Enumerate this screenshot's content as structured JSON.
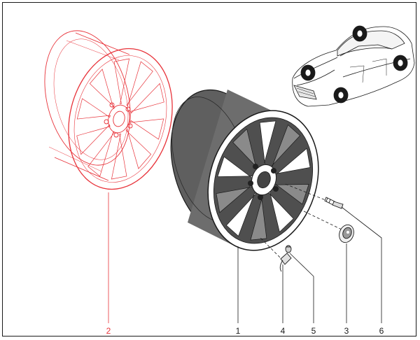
{
  "callouts": [
    {
      "label": "2",
      "variant": "red"
    },
    {
      "label": "1",
      "variant": "dark"
    },
    {
      "label": "4",
      "variant": "dark"
    },
    {
      "label": "5",
      "variant": "dark"
    },
    {
      "label": "3",
      "variant": "dark"
    },
    {
      "label": "6",
      "variant": "dark"
    }
  ],
  "colors": {
    "outline": "#1a1a1a",
    "highlight": "#e8333a",
    "rim_fill": "#6b6b6b",
    "spoke_dark": "#555555",
    "spoke_light": "#ffffff"
  },
  "icons": [
    "car-locator-icon",
    "wheel-hub-icon"
  ]
}
